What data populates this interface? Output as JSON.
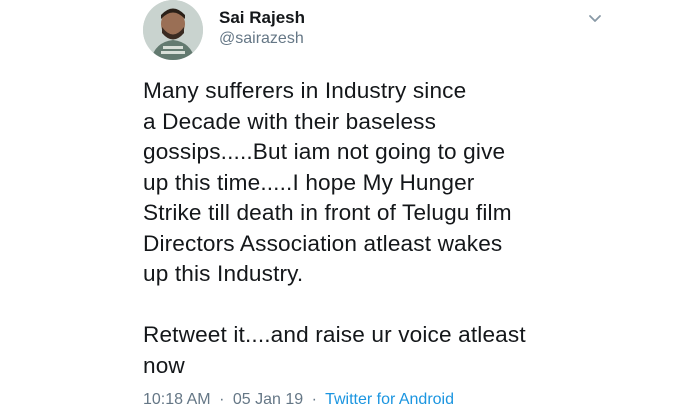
{
  "user": {
    "display_name": "Sai Rajesh",
    "handle": "@sairazesh"
  },
  "tweet": {
    "text": "Many sufferers in Industry since\na Decade with their baseless\ngossips.....But iam not going to give\nup this time.....I hope My Hunger\nStrike till death in front of Telugu film\nDirectors Association atleast wakes\nup this Industry.\n\nRetweet it....and raise ur voice atleast\nnow"
  },
  "footer": {
    "time": "10:18 AM",
    "separator": "·",
    "date": "05 Jan 19",
    "source": "Twitter for Android"
  },
  "colors": {
    "text": "#14171a",
    "muted": "#657786",
    "link": "#1b95e0"
  },
  "icons": {
    "menu": "chevron-down-icon"
  }
}
